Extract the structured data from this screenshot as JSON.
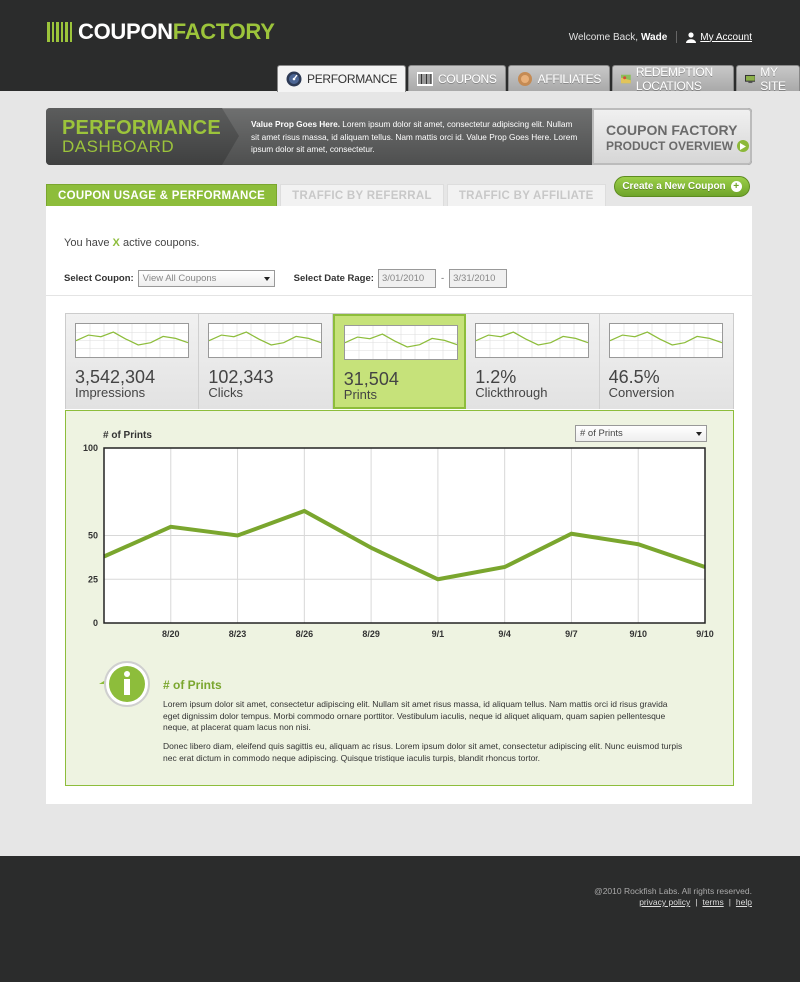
{
  "brand": {
    "part1": "COUPON",
    "part2": "FACTORY"
  },
  "header": {
    "welcome": "Welcome Back,",
    "user": "Wade",
    "account_link": "My Account"
  },
  "nav": [
    {
      "label": "Performance",
      "icon": "speedometer-icon",
      "active": true
    },
    {
      "label": "Coupons",
      "icon": "barcode-icon",
      "active": false
    },
    {
      "label": "Affiliates",
      "icon": "seal-icon",
      "active": false
    },
    {
      "label": "Redemption Locations",
      "icon": "map-icon",
      "active": false
    },
    {
      "label": "My Site",
      "icon": "monitor-icon",
      "active": false
    }
  ],
  "banner": {
    "title1": "PERFORMANCE",
    "title2": "DASHBOARD",
    "text_bold": "Value Prop Goes Here.",
    "text": " Lorem ipsum dolor sit amet, consectetur adipiscing elit. Nullam sit amet risus massa, id aliquam tellus. Nam mattis orci id. Value Prop Goes Here. Lorem ipsum dolor sit amet, consectetur.",
    "overview_title": "COUPON FACTORY",
    "overview_link": "PRODUCT OVERVIEW"
  },
  "subtabs": [
    {
      "label": "COUPON USAGE & PERFORMANCE",
      "active": true
    },
    {
      "label": "TRAFFIC BY REFERRAL",
      "active": false
    },
    {
      "label": "TRAFFIC BY AFFILIATE",
      "active": false
    }
  ],
  "new_coupon_label": "Create a New Coupon",
  "active_coupons": {
    "prefix": "You have",
    "count": "X",
    "suffix": "active coupons."
  },
  "filters": {
    "coupon_label": "Select Coupon:",
    "coupon_value": "View All Coupons",
    "date_label": "Select Date Rage:",
    "date_from": "3/01/2010",
    "date_sep": "-",
    "date_to": "3/31/2010"
  },
  "metrics": [
    {
      "value": "3,542,304",
      "label": "Impressions",
      "active": false
    },
    {
      "value": "102,343",
      "label": "Clicks",
      "active": false
    },
    {
      "value": "31,504",
      "label": "Prints",
      "active": true
    },
    {
      "value": "1.2%",
      "label": "Clickthrough",
      "active": false
    },
    {
      "value": "46.5%",
      "label": "Conversion",
      "active": false
    }
  ],
  "chart": {
    "title": "# of Prints",
    "dropdown": "# of Prints"
  },
  "chart_data": {
    "type": "line",
    "title": "# of Prints",
    "categories": [
      "",
      "8/20",
      "8/23",
      "8/26",
      "8/29",
      "9/1",
      "9/4",
      "9/7",
      "9/10",
      "9/10"
    ],
    "values": [
      38,
      55,
      50,
      64,
      43,
      25,
      32,
      51,
      45,
      32
    ],
    "ylim": [
      0,
      100
    ],
    "yticks": [
      0,
      25,
      50,
      100
    ],
    "grid": true,
    "color": "#7aa62e"
  },
  "info": {
    "title": "# of Prints",
    "p1": "Lorem ipsum dolor sit amet, consectetur adipiscing elit. Nullam sit amet risus massa, id aliquam tellus. Nam mattis orci id risus gravida eget dignissim dolor tempus. Morbi commodo ornare porttitor. Vestibulum iaculis, neque id aliquet aliquam, quam sapien pellentesque neque, at placerat quam lacus non nisi.",
    "p2": "Donec libero diam, eleifend quis sagittis eu, aliquam ac risus. Lorem ipsum dolor sit amet, consectetur adipiscing elit. Nunc euismod turpis nec erat dictum in commodo neque adipiscing. Quisque tristique iaculis turpis, blandit rhoncus tortor."
  },
  "footer": {
    "copyright": "@2010 Rockfish Labs. All rights reserved.",
    "links": [
      "privacy policy",
      "terms",
      "help"
    ]
  }
}
